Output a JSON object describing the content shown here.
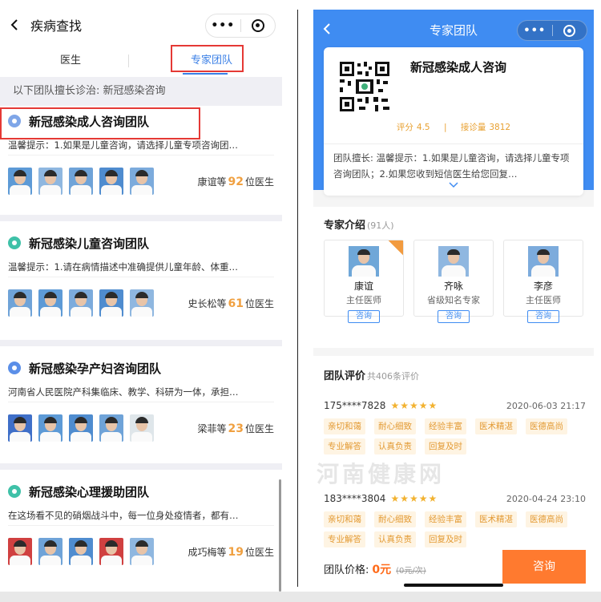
{
  "left": {
    "nav": {
      "title": "疾病查找",
      "menu_dots": "•••"
    },
    "tabs": [
      {
        "label": "医生",
        "active": false
      },
      {
        "label": "专家团队",
        "active": true
      }
    ],
    "subtitle": "以下团队擅长诊治: 新冠感染咨询",
    "teams": [
      {
        "name": "新冠感染成人咨询团队",
        "desc": "温馨提示：1.如果是儿童咨询，请选择儿童专项咨询团…",
        "lead": "康谊等",
        "count": "92",
        "suffix": "位医生",
        "icon_color": "#7fa6e8"
      },
      {
        "name": "新冠感染儿童咨询团队",
        "desc": "温馨提示：1.请在病情描述中准确提供儿童年龄、体重…",
        "lead": "史长松等",
        "count": "61",
        "suffix": "位医生",
        "icon_color": "#3fc1a8"
      },
      {
        "name": "新冠感染孕产妇咨询团队",
        "desc": "河南省人民医院产科集临床、教学、科研为一体，承担…",
        "lead": "梁菲等",
        "count": "23",
        "suffix": "位医生",
        "icon_color": "#5b8fe8"
      },
      {
        "name": "新冠感染心理援助团队",
        "desc": "在这场看不见的硝烟战斗中，每一位身处疫情者，都有…",
        "lead": "成巧梅等",
        "count": "19",
        "suffix": "位医生",
        "icon_color": "#3fc1a8"
      }
    ]
  },
  "right": {
    "nav": {
      "title": "专家团队",
      "menu_dots": "•••"
    },
    "team_card": {
      "name": "新冠感染成人咨询",
      "score_label": "评分",
      "score": "4.5",
      "visits_label": "接诊量",
      "visits": "3812",
      "desc": "团队擅长: 温馨提示：1.如果是儿童咨询，请选择儿童专项咨询团队；2.如果您收到短信医生给您回复…"
    },
    "experts_section": {
      "title": "专家介绍",
      "count": "(91人)"
    },
    "experts": [
      {
        "name": "康谊",
        "title": "主任医师",
        "btn": "咨询"
      },
      {
        "name": "齐咏",
        "title": "省级知名专家",
        "btn": "咨询"
      },
      {
        "name": "李彦",
        "title": "主任医师",
        "btn": "咨询"
      }
    ],
    "reviews_section": {
      "title": "团队评价",
      "count": "共406条评价"
    },
    "reviews": [
      {
        "user": "175****7828",
        "stars": "★★★★★",
        "date": "2020-06-03 21:17",
        "tags": [
          "亲切和蔼",
          "耐心细致",
          "经验丰富",
          "医术精湛",
          "医德高尚",
          "专业解答",
          "认真负责",
          "回复及时"
        ]
      },
      {
        "user": "183****3804",
        "stars": "★★★★★",
        "date": "2020-04-24 23:10",
        "tags": [
          "亲切和蔼",
          "耐心细致",
          "经验丰富",
          "医术精湛",
          "医德高尚",
          "专业解答",
          "认真负责",
          "回复及时"
        ]
      }
    ],
    "watermark": "河南健康网",
    "footer": {
      "price_label": "团队价格:",
      "price": "0元",
      "old_price": "(0元/次)",
      "consult": "咨询"
    }
  }
}
